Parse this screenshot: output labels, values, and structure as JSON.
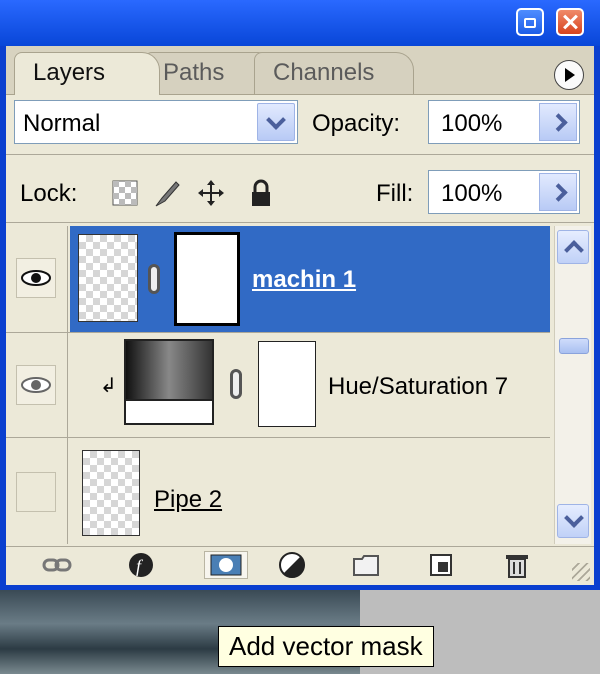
{
  "tabs": {
    "layers": "Layers",
    "paths": "Paths",
    "channels": "Channels"
  },
  "blend_mode": "Normal",
  "opacity": {
    "label": "Opacity:",
    "value": "100%"
  },
  "lock": {
    "label": "Lock:"
  },
  "fill": {
    "label": "Fill:",
    "value": "100%"
  },
  "layers": [
    {
      "name": "machin 1",
      "visible": true,
      "selected": true
    },
    {
      "name": "Hue/Saturation 7",
      "visible": true,
      "selected": false
    },
    {
      "name": "Pipe 2",
      "visible": false,
      "selected": false
    }
  ],
  "tooltip": "Add vector mask",
  "colors": {
    "titlebar": "#0846d8",
    "panel": "#ece9d8",
    "selection": "#316ac5",
    "tooltip_bg": "#ffffe1"
  },
  "icons": [
    "minimize-icon",
    "close-icon",
    "palette-menu-icon",
    "lock-transparent-icon",
    "lock-image-icon",
    "lock-position-icon",
    "lock-all-icon",
    "link-layers-icon",
    "layer-style-icon",
    "add-mask-icon",
    "adjustment-layer-icon",
    "new-group-icon",
    "new-layer-icon",
    "trash-icon"
  ]
}
